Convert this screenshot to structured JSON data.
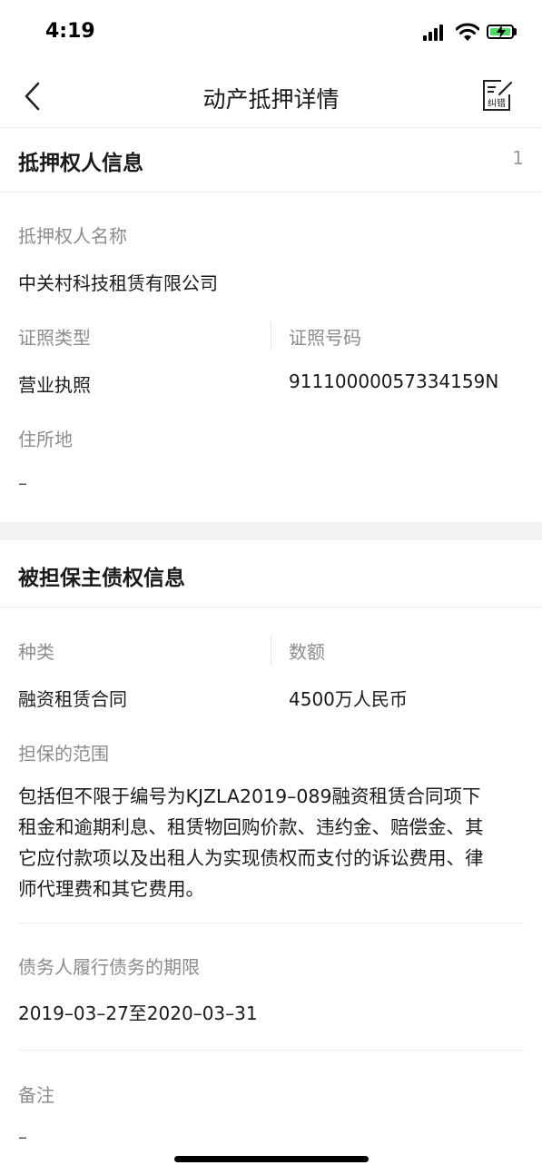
{
  "status": {
    "time": "4:19"
  },
  "nav": {
    "title": "动产抵押详情",
    "correct_label": "纠错"
  },
  "mortgagee": {
    "title": "抵押权人信息",
    "count": "1",
    "name_label": "抵押权人名称",
    "name_value": "中关村科技租赁有限公司",
    "cert_type_label": "证照类型",
    "cert_type_value": "营业执照",
    "cert_no_label": "证照号码",
    "cert_no_value": "91110000057334159N",
    "address_label": "住所地",
    "address_value": "–"
  },
  "secured_claim": {
    "title": "被担保主债权信息",
    "kind_label": "种类",
    "kind_value": "融资租赁合同",
    "amount_label": "数额",
    "amount_value": "4500万人民币",
    "scope_label": "担保的范围",
    "scope_lines": [
      "包括但不限于编号为KJZLA2019–089融资租赁合同项下",
      "租金和逾期利息、租赁物回购价款、违约金、赔偿金、其",
      "它应付款项以及出租人为实现债权而支付的诉讼费用、律",
      "师代理费和其它费用。"
    ],
    "term_label": "债务人履行债务的期限",
    "term_value": "2019–03–27至2020–03–31",
    "remark_label": "备注",
    "remark_value": "–"
  }
}
